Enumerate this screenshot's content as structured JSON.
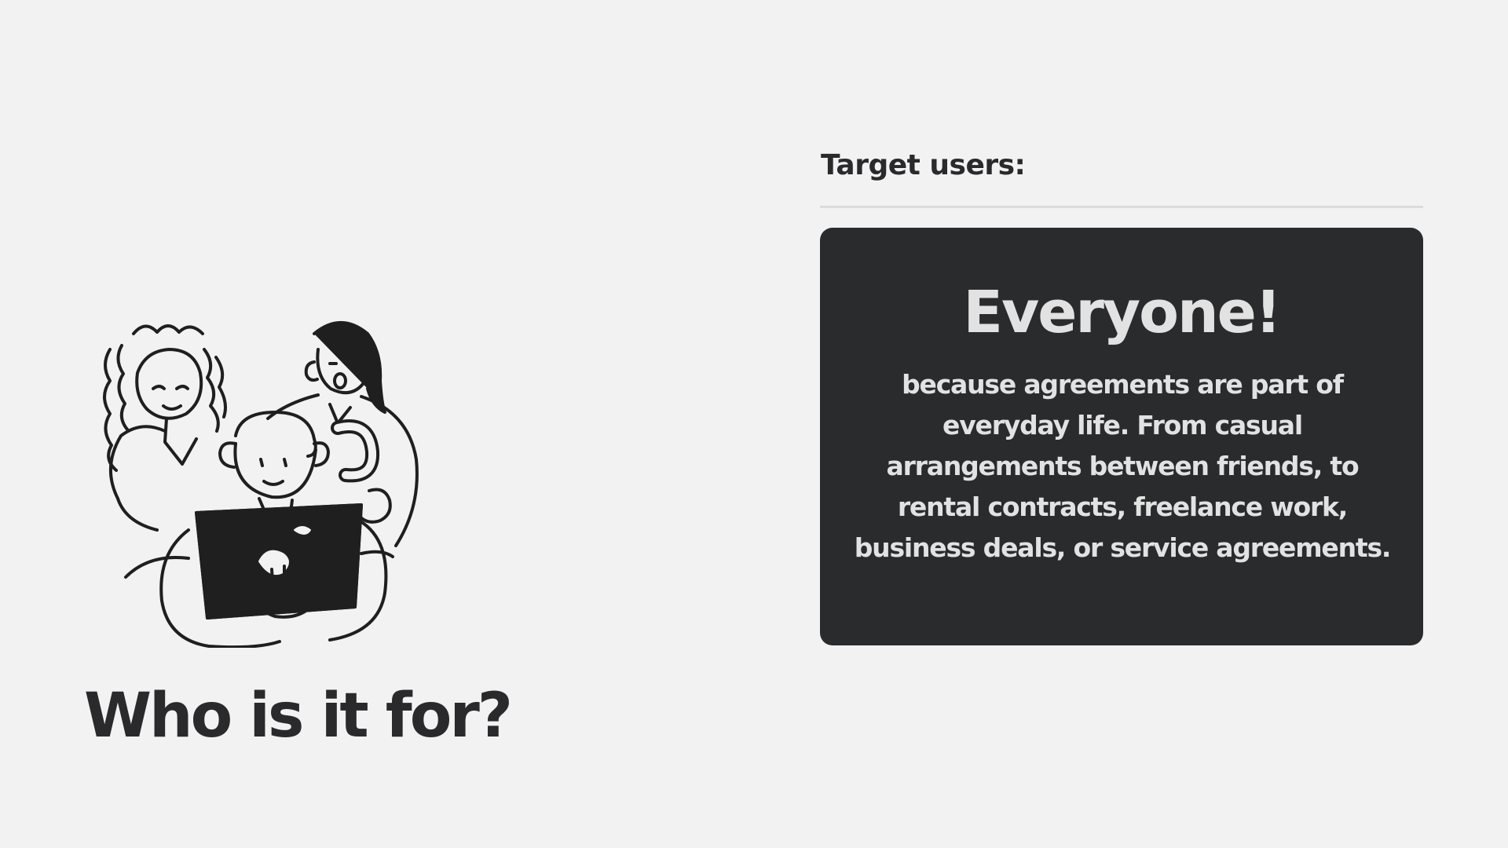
{
  "slide": {
    "title": "Who is it for?",
    "illustration": {
      "icon": "people-around-laptop-icon"
    }
  },
  "target": {
    "label": "Target users:",
    "card": {
      "heading": "Everyone!",
      "body": "because agreements are part of everyday life. From casual arrangements between friends, to rental contracts, freelance work, business deals, or service agreements."
    }
  },
  "colors": {
    "background": "#f2f2f2",
    "card_background": "#2a2b2d",
    "card_text": "#e2e2e2",
    "heading_text": "#2a2a2c",
    "divider": "#dcdcdc"
  }
}
